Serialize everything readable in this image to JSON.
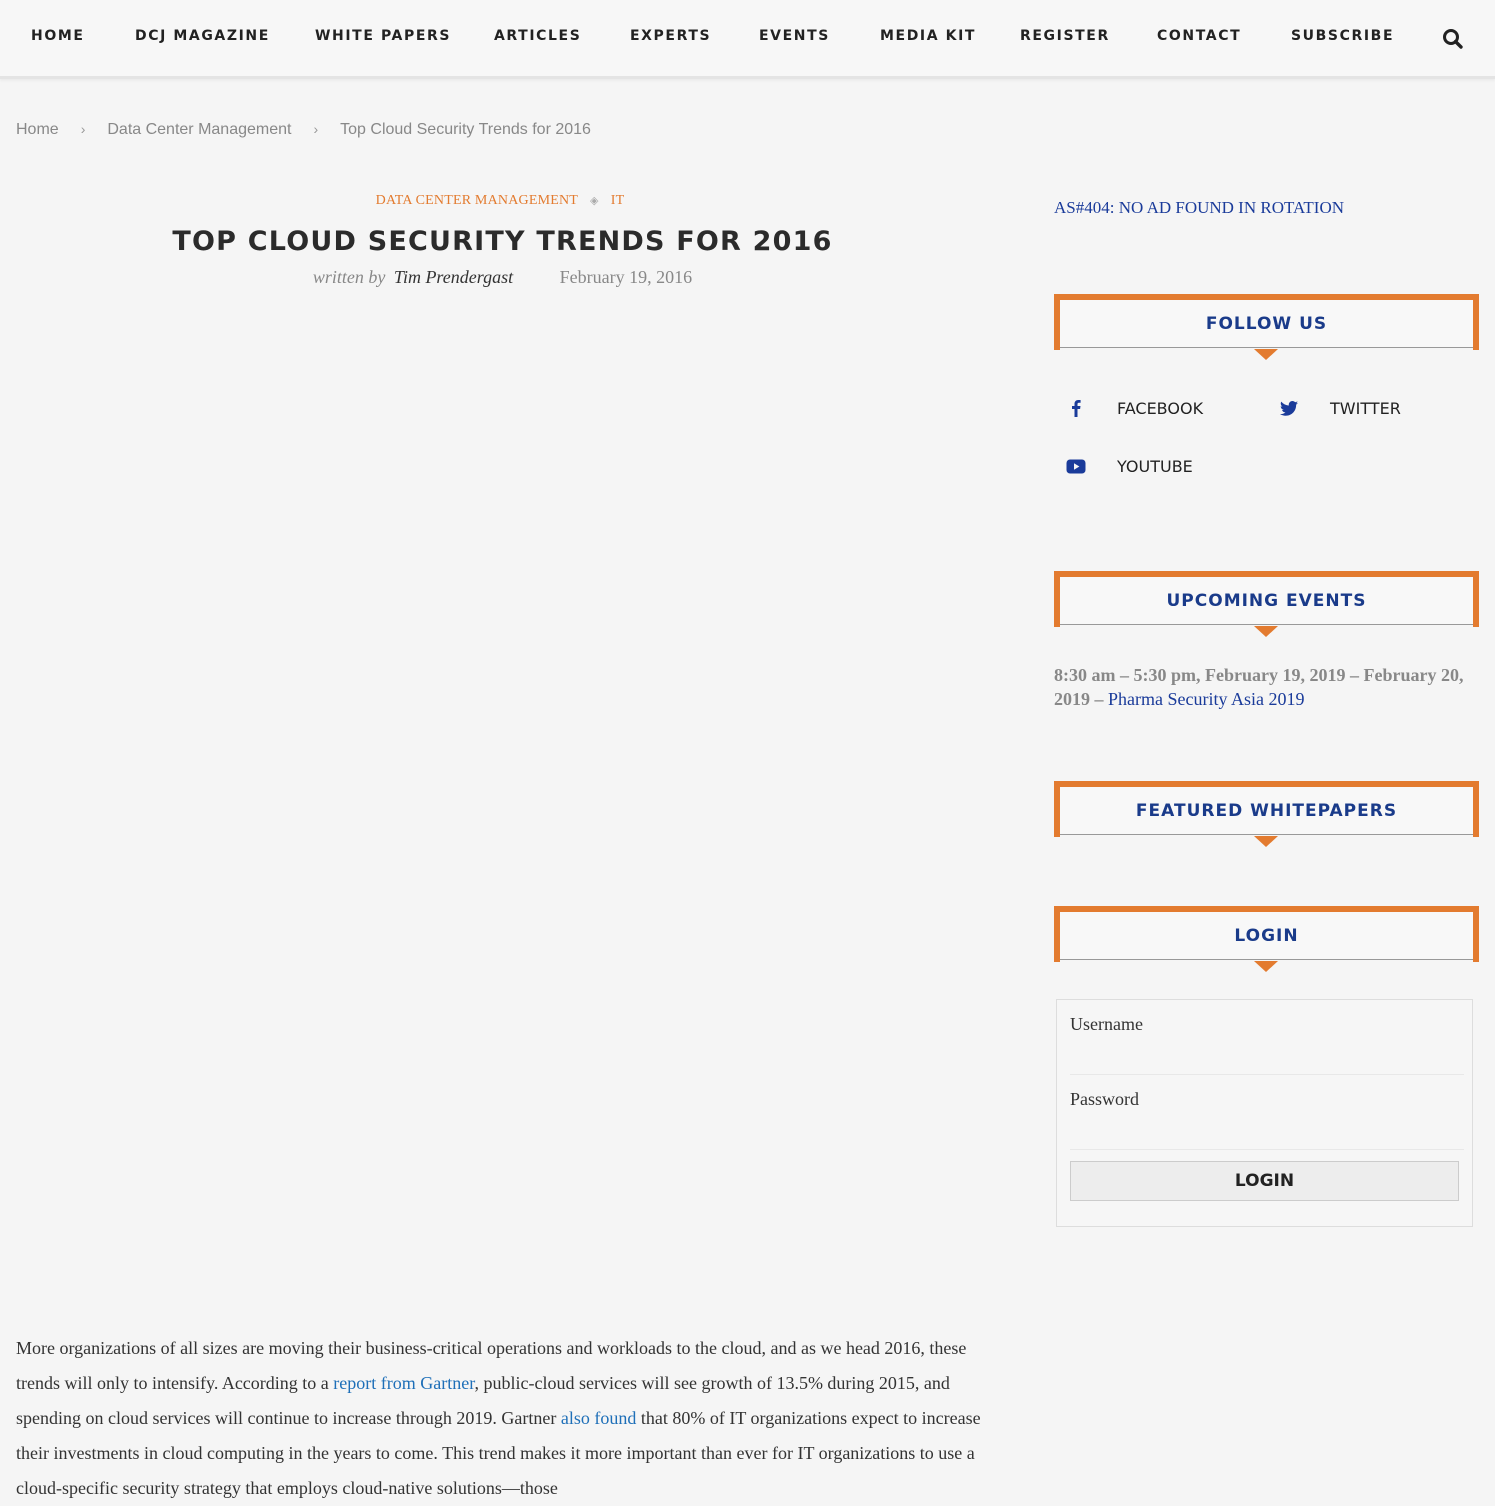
{
  "nav": {
    "items": [
      "HOME",
      "DCJ MAGAZINE",
      "WHITE PAPERS",
      "ARTICLES",
      "EXPERTS",
      "EVENTS",
      "MEDIA KIT",
      "REGISTER",
      "CONTACT",
      "SUBSCRIBE"
    ],
    "search_icon": "search-icon"
  },
  "breadcrumb": {
    "items": [
      "Home",
      "Data Center Management",
      "Top Cloud Security Trends for 2016"
    ],
    "separator": "›"
  },
  "article": {
    "categories": [
      "DATA CENTER MANAGEMENT",
      "IT"
    ],
    "category_separator": "◈",
    "title": "TOP CLOUD SECURITY TRENDS FOR 2016",
    "written_by": "written by",
    "author": "Tim Prendergast",
    "date": "February 19, 2016",
    "body": {
      "p1": "More organizations of all sizes are moving their business-critical operations and workloads to the cloud, and as we head 2016, these trends will only to intensify. According to a ",
      "link1": "report from Gartner",
      "p2": ", public-cloud services will see growth of 13.5% during 2015, and spending on cloud services will continue to increase through 2019. Gartner ",
      "link2": "also found",
      "p3": " that 80% of IT organizations expect to increase their investments in cloud computing in the years to come. This trend makes it more important than ever for IT organizations to use a cloud-specific security strategy that employs cloud-native solutions—those"
    }
  },
  "sidebar": {
    "ad_text": "AS#404: NO AD FOUND IN ROTATION",
    "follow_us": {
      "title": "FOLLOW US",
      "links": [
        {
          "label": "FACEBOOK",
          "icon": "facebook-icon"
        },
        {
          "label": "TWITTER",
          "icon": "twitter-icon"
        },
        {
          "label": "YOUTUBE",
          "icon": "youtube-icon"
        }
      ]
    },
    "upcoming_events": {
      "title": "UPCOMING EVENTS",
      "time": "8:30 am – 5:30 pm, February 19, 2019 – February 20, 2019 – ",
      "event_link": "Pharma Security Asia 2019"
    },
    "featured_whitepapers": {
      "title": "FEATURED WHITEPAPERS"
    },
    "login": {
      "title": "LOGIN",
      "username_label": "Username",
      "username_value": "",
      "password_label": "Password",
      "password_value": "",
      "button_label": "LOGIN"
    }
  },
  "colors": {
    "accent_orange": "#e37b2f",
    "heading_blue": "#1a3b8a",
    "link_blue": "#1e6fb8",
    "background": "#f5f5f5"
  }
}
